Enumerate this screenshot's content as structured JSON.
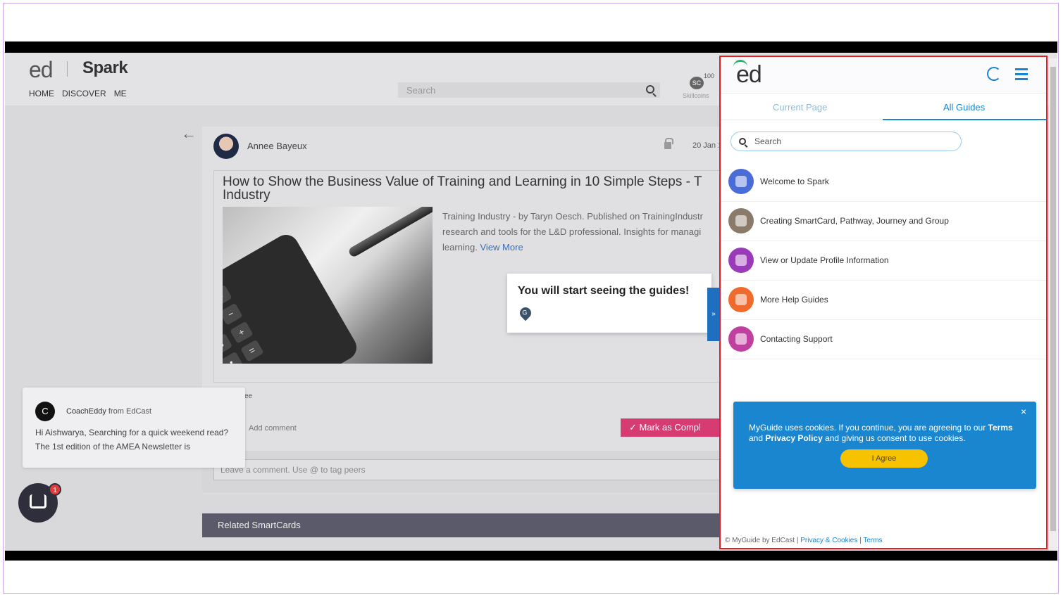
{
  "app": {
    "logo_ed": "ed",
    "logo_spark": "Spark",
    "nav": [
      "HOME",
      "DISCOVER",
      "ME"
    ],
    "search_placeholder": "Search",
    "skillcoins_count": "100",
    "skillcoins_badge": "SC",
    "skillcoins_label": "Skillcoins"
  },
  "card": {
    "author": "Annee Bayeux",
    "date": "20 Jan :",
    "title": "How to Show the Business Value of Training and Learning in 10 Simple Steps - T Industry",
    "description": "Training Industry - by Taryn Oesch. Published on TrainingIndustr research and tools for the L&D professional. Insights for managi learning.",
    "view_more": "View More",
    "below_text": "ee",
    "add_comment": "Add comment",
    "mark_complete": "✓ Mark as Compl",
    "comment_placeholder": "Leave a comment. Use @ to tag peers",
    "related": "Related SmartCards"
  },
  "chat": {
    "avatar_letter": "C",
    "from_name": "CoachEddy",
    "from_suffix": " from EdCast",
    "message": "Hi Aishwarya, Searching for a quick weekend read? The 1st edition of the AMEA Newsletter is",
    "badge_count": "1"
  },
  "tooltip": {
    "text": "You will start seeing the guides!",
    "icon_letter": "G",
    "tab_glyph": "»"
  },
  "panel": {
    "logo": "ed",
    "tabs": [
      "Current Page",
      "All Guides"
    ],
    "active_tab": "All Guides",
    "search_placeholder": "Search",
    "guides": [
      {
        "label": "Welcome to Spark",
        "color": "#4a6cd8"
      },
      {
        "label": "Creating SmartCard, Pathway, Journey and Group",
        "color": "#8a7a6a"
      },
      {
        "label": "View or Update Profile Information",
        "color": "#9b3ab8"
      },
      {
        "label": "More Help Guides",
        "color": "#f06a2e"
      },
      {
        "label": "Contacting Support",
        "color": "#c040a0"
      }
    ],
    "cookie": {
      "close": "×",
      "text_1": "MyGuide uses cookies. If you continue, you are agreeing to our ",
      "terms": "Terms",
      "and": " and ",
      "privacy": "Privacy Policy",
      "text_2": " and giving us consent to use cookies.",
      "agree": "I Agree"
    },
    "footer": {
      "copyright": "© MyGuide by EdCast",
      "privacy_link": "Privacy & Cookies",
      "terms_link": "Terms",
      "sep": " | "
    }
  },
  "colors": {
    "accent": "#1b86d0",
    "highlight_border": "#e21e26",
    "mark_button": "#d63c72",
    "agree_button": "#f7c200"
  }
}
